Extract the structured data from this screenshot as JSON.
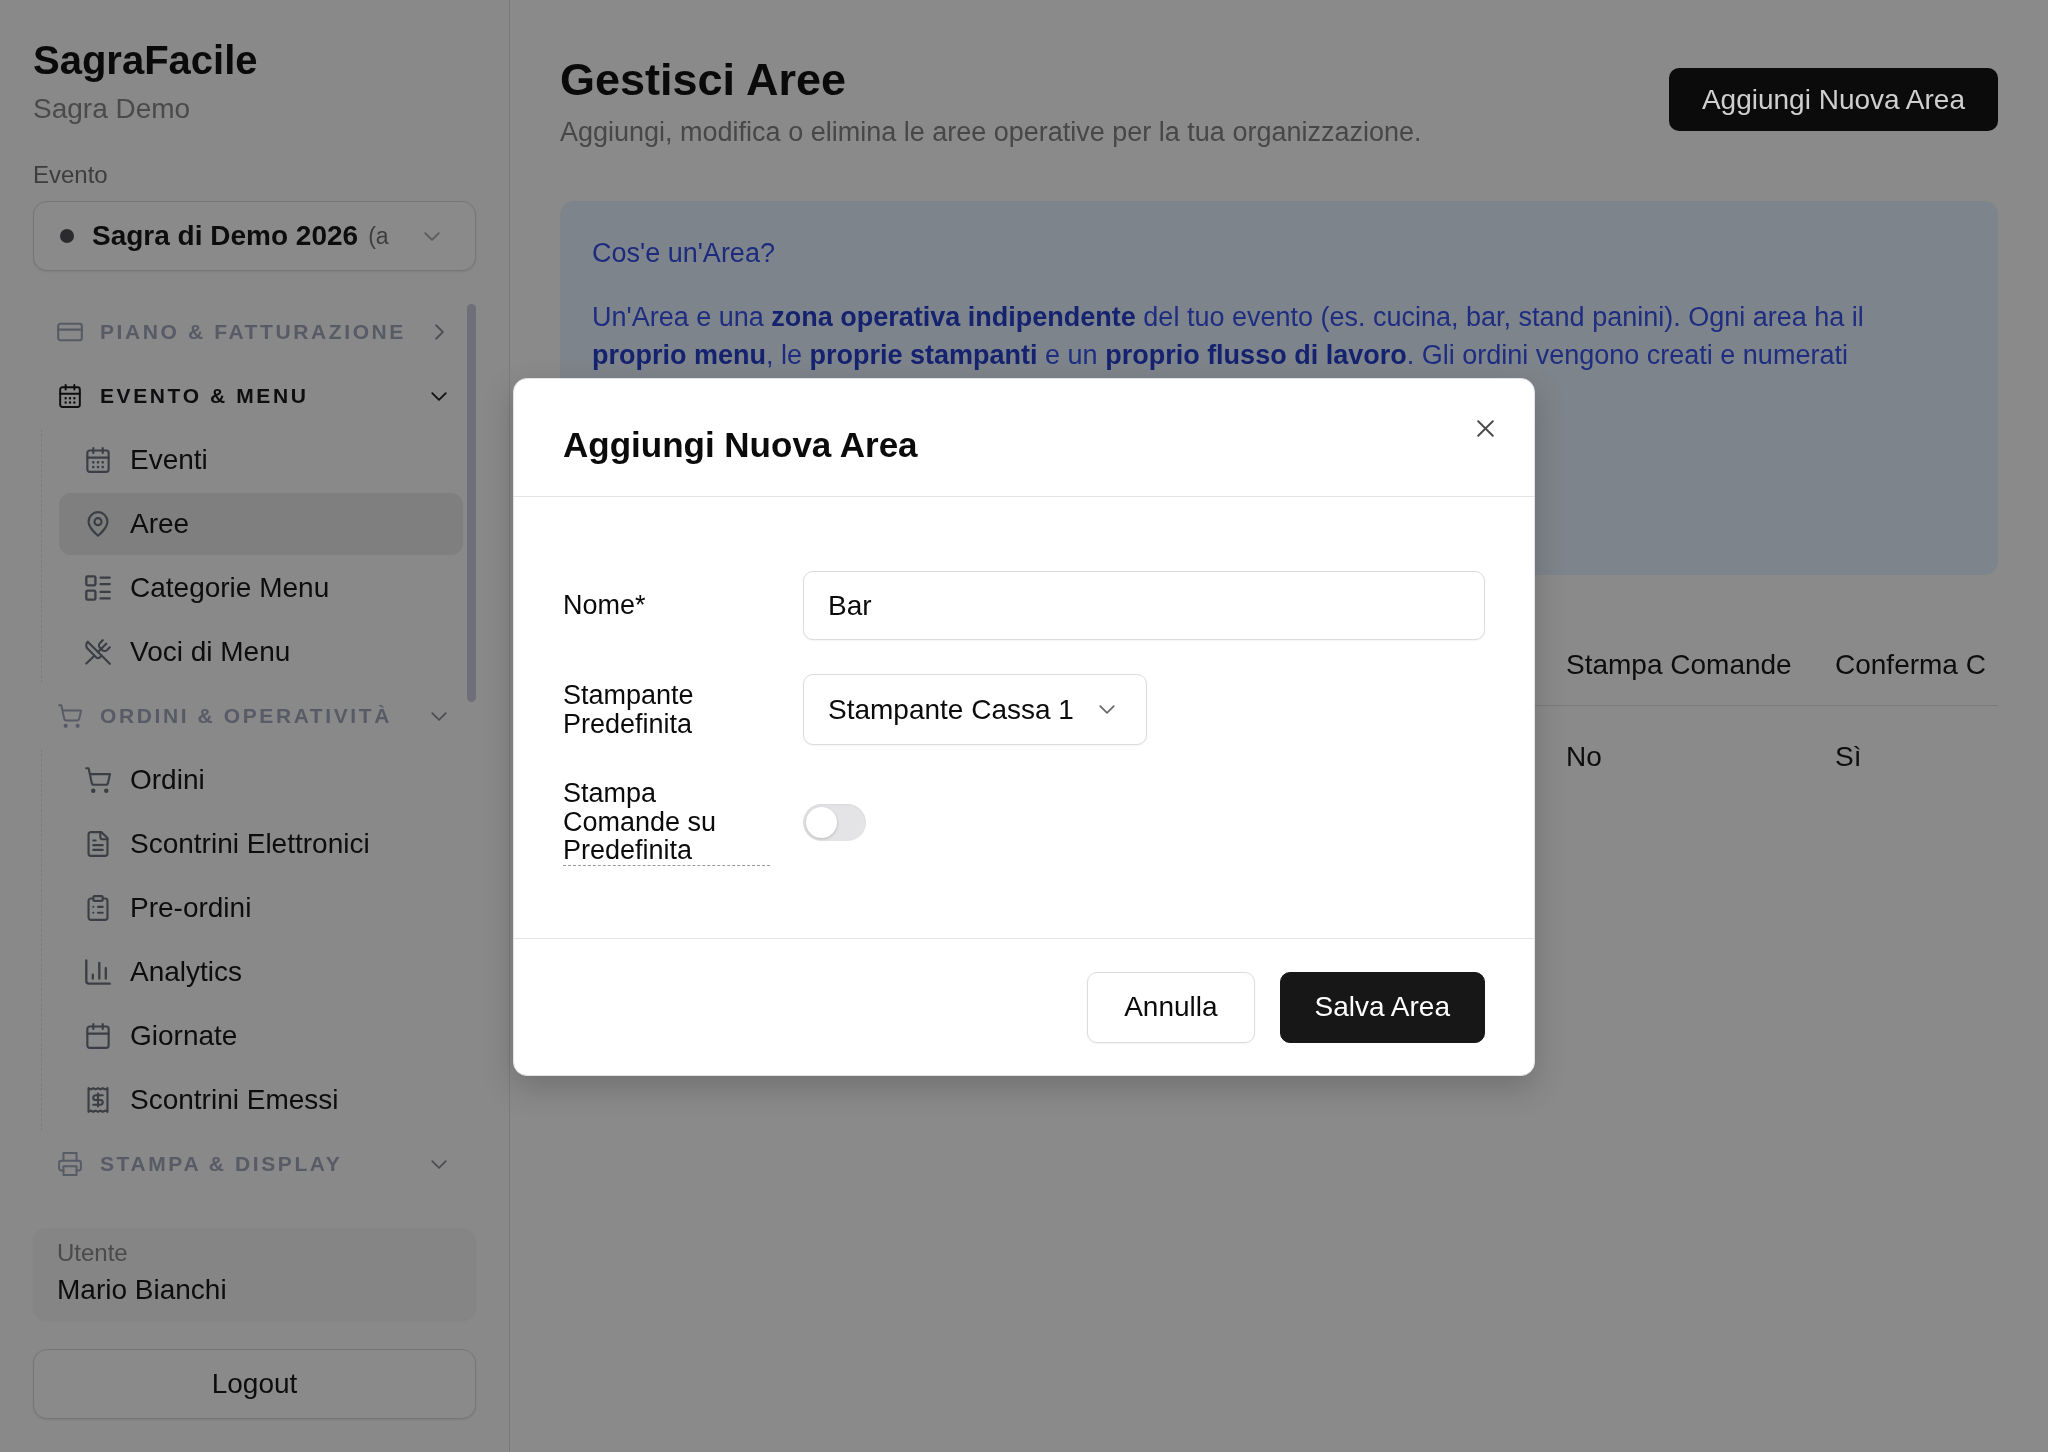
{
  "sidebar": {
    "app_name": "SagraFacile",
    "organization": "Sagra Demo",
    "event_label": "Evento",
    "event_select": {
      "value": "Sagra di Demo 2026",
      "note": "(a"
    },
    "sections": [
      {
        "label": "PIANO & FATTURAZIONE",
        "expanded": false
      },
      {
        "label": "EVENTO & MENU",
        "expanded": true,
        "items": [
          {
            "label": "Eventi",
            "selected": false
          },
          {
            "label": "Aree",
            "selected": true
          },
          {
            "label": "Categorie Menu",
            "selected": false
          },
          {
            "label": "Voci di Menu",
            "selected": false
          }
        ]
      },
      {
        "label": "ORDINI & OPERATIVITÀ",
        "expanded": true,
        "items": [
          {
            "label": "Ordini",
            "selected": false
          },
          {
            "label": "Scontrini Elettronici",
            "selected": false
          },
          {
            "label": "Pre-ordini",
            "selected": false
          },
          {
            "label": "Analytics",
            "selected": false
          },
          {
            "label": "Giornate",
            "selected": false
          },
          {
            "label": "Scontrini Emessi",
            "selected": false
          }
        ]
      },
      {
        "label": "STAMPA & DISPLAY",
        "expanded": true
      }
    ],
    "user": {
      "label": "Utente",
      "name": "Mario Bianchi"
    },
    "logout_button": "Logout"
  },
  "header": {
    "title": "Gestisci Aree",
    "subtitle": "Aggiungi, modifica o elimina le aree operative per la tua organizzazione.",
    "add_button": "Aggiungi Nuova Area"
  },
  "info_box": {
    "title": "Cos'e un'Area?",
    "text": "Un'Area e una **zona operativa indipendente** del tuo evento (es. cucina, bar, stand panini). Ogni area ha il **proprio menu**, le **proprie stampanti** e un **proprio flusso di lavoro**. Gli ordini vengono creati e numerati"
  },
  "table": {
    "columns": [
      "Stampa Comande",
      "Conferma C"
    ],
    "rows": [
      [
        "No",
        "Sì"
      ]
    ]
  },
  "modal": {
    "title": "Aggiungi Nuova Area",
    "fields": [
      {
        "kind": "text",
        "label": "Nome*",
        "value": "Bar",
        "has_tooltip": false
      },
      {
        "kind": "select",
        "label": "Stampante Predefinita",
        "value": "Stampante Cassa 1",
        "has_tooltip": false
      },
      {
        "kind": "toggle",
        "label": "Stampa Comande su Predefinita",
        "on": false,
        "has_tooltip": true
      }
    ],
    "buttons": [
      {
        "label": "Annulla",
        "kind": "secondary"
      },
      {
        "label": "Salva Area",
        "kind": "primary"
      }
    ]
  }
}
